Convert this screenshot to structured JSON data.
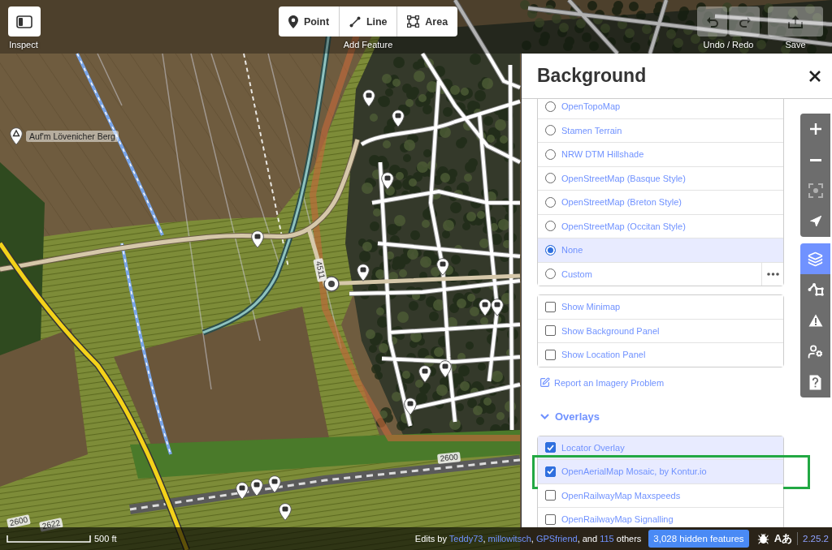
{
  "toolbar": {
    "inspect": {
      "label": "Inspect"
    },
    "add_feature": {
      "label": "Add Feature",
      "buttons": [
        {
          "kind": "point",
          "label": "Point"
        },
        {
          "kind": "line",
          "label": "Line"
        },
        {
          "kind": "area",
          "label": "Area"
        }
      ]
    },
    "history": {
      "label": "Undo / Redo",
      "buttons": [
        {
          "kind": "undo",
          "disabled": true
        },
        {
          "kind": "redo",
          "disabled": true
        }
      ]
    },
    "save": {
      "label": "Save",
      "disabled": true
    }
  },
  "map": {
    "labels": [
      {
        "kind": "place",
        "text": "Auf'm Lövenicher Berg"
      },
      {
        "kind": "road",
        "text": "4511"
      },
      {
        "kind": "road",
        "text": "2600"
      },
      {
        "kind": "road",
        "text": "2600"
      },
      {
        "kind": "road",
        "text": "2622"
      }
    ]
  },
  "background_panel": {
    "title": "Background",
    "backgrounds": [
      {
        "kind": "source",
        "label": "OpenTopoMap",
        "selected": false
      },
      {
        "kind": "source",
        "label": "Stamen Terrain",
        "selected": false
      },
      {
        "kind": "source",
        "label": "NRW DTM Hillshade",
        "selected": false
      },
      {
        "kind": "source",
        "label": "OpenStreetMap (Basque Style)",
        "selected": false
      },
      {
        "kind": "source",
        "label": "OpenStreetMap (Breton Style)",
        "selected": false
      },
      {
        "kind": "source",
        "label": "OpenStreetMap (Occitan Style)",
        "selected": false
      },
      {
        "kind": "source",
        "label": "None",
        "selected": true
      },
      {
        "kind": "custom",
        "label": "Custom",
        "selected": false
      }
    ],
    "display_options": [
      {
        "label": "Show Minimap",
        "checked": false
      },
      {
        "label": "Show Background Panel",
        "checked": false
      },
      {
        "label": "Show Location Panel",
        "checked": false
      }
    ],
    "report_link": "Report an Imagery Problem",
    "overlays": {
      "title": "Overlays",
      "expanded": true,
      "items": [
        {
          "label": "Locator Overlay",
          "checked": true,
          "highlighted": false
        },
        {
          "label": "OpenAerialMap Mosaic, by Kontur.io",
          "checked": true,
          "highlighted": true
        },
        {
          "label": "OpenRailwayMap Maxspeeds",
          "checked": false,
          "highlighted": false
        },
        {
          "label": "OpenRailwayMap Signalling",
          "checked": false,
          "highlighted": false
        }
      ]
    }
  },
  "map_controls": {
    "zoom": [
      {
        "kind": "zoom_in",
        "disabled": false
      },
      {
        "kind": "zoom_out",
        "disabled": false
      },
      {
        "kind": "zoom_to_selection",
        "disabled": true
      },
      {
        "kind": "geolocate",
        "disabled": false
      }
    ],
    "panes": [
      {
        "kind": "background",
        "selected": true
      },
      {
        "kind": "map_data",
        "selected": false
      },
      {
        "kind": "issues",
        "selected": false
      },
      {
        "kind": "preferences",
        "selected": false
      },
      {
        "kind": "help",
        "selected": false
      }
    ]
  },
  "footer": {
    "scale": "500 ft",
    "edits": [
      {
        "kind": "text",
        "text": "Edits by "
      },
      {
        "kind": "link",
        "text": "Teddy73"
      },
      {
        "kind": "text",
        "text": ", "
      },
      {
        "kind": "link",
        "text": "millowitsch"
      },
      {
        "kind": "text",
        "text": ", "
      },
      {
        "kind": "link",
        "text": "GPSfriend"
      },
      {
        "kind": "text",
        "text": ", and "
      },
      {
        "kind": "link",
        "text": "115"
      },
      {
        "kind": "text",
        "text": " others"
      }
    ],
    "hidden_features": "3,028 hidden features",
    "language": "Aあ",
    "version": "2.25.2"
  }
}
